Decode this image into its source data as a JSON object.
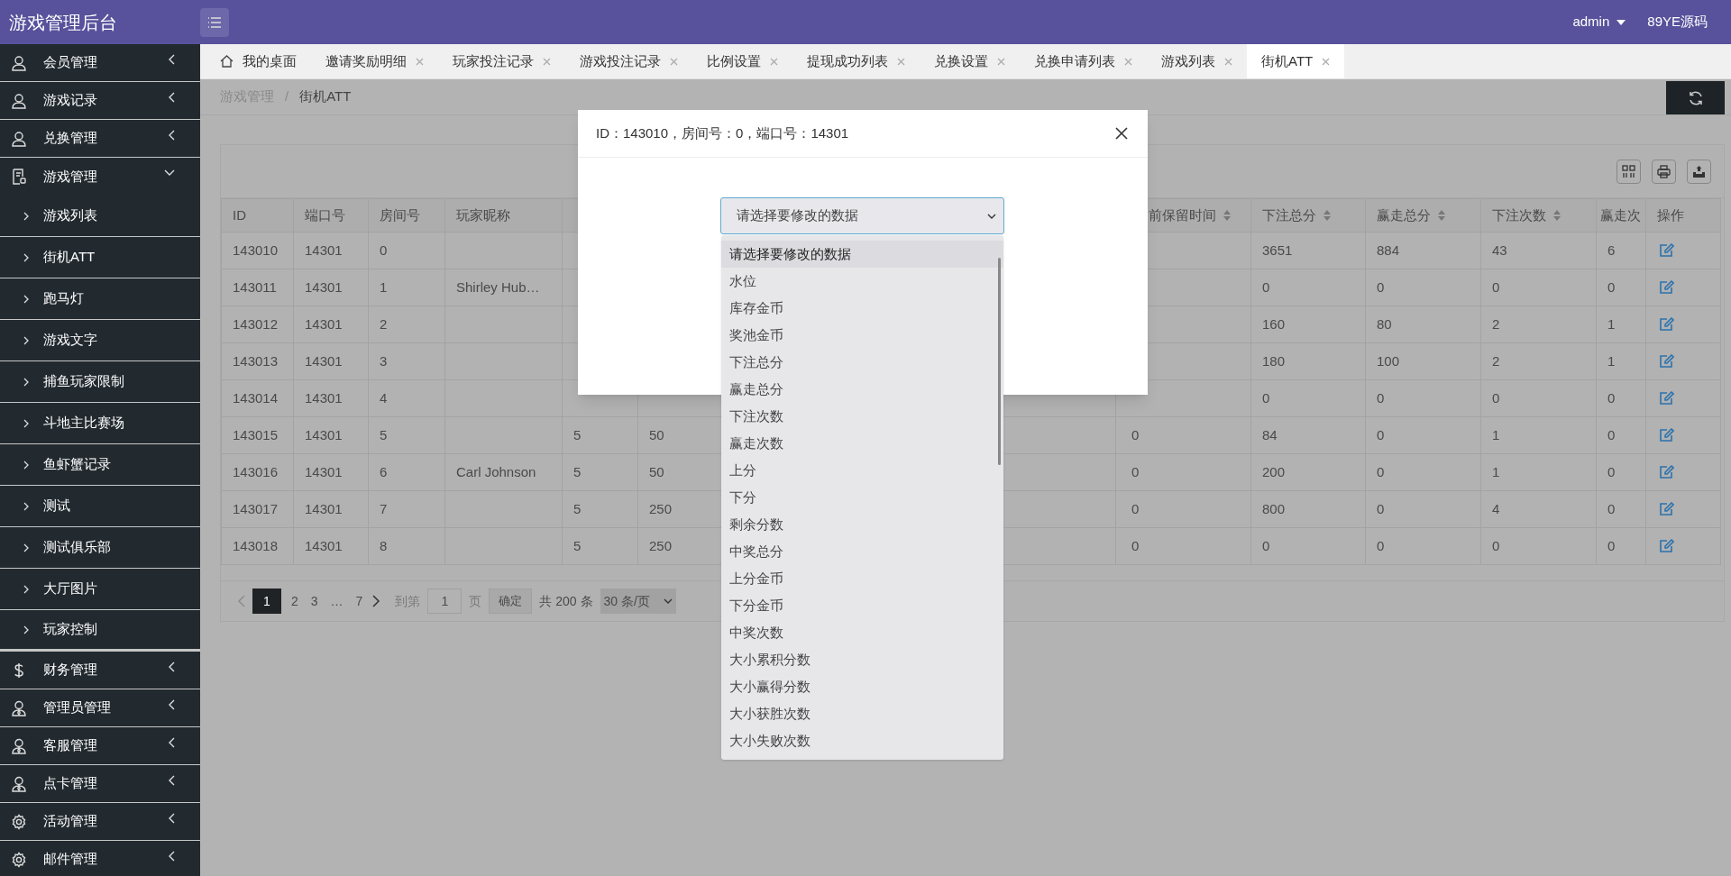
{
  "header": {
    "title": "游戏管理后台",
    "user": "admin",
    "link": "89YE源码"
  },
  "sidebar": {
    "items": [
      {
        "label": "会员管理",
        "kind": "user",
        "expanded": false
      },
      {
        "label": "游戏记录",
        "kind": "user",
        "expanded": false
      },
      {
        "label": "兑换管理",
        "kind": "user",
        "expanded": false
      },
      {
        "label": "游戏管理",
        "kind": "doc",
        "expanded": true,
        "children": [
          {
            "label": "游戏列表"
          },
          {
            "label": "街机ATT"
          },
          {
            "label": "跑马灯"
          },
          {
            "label": "游戏文字"
          },
          {
            "label": "捕鱼玩家限制"
          },
          {
            "label": "斗地主比赛场"
          },
          {
            "label": "鱼虾蟹记录"
          },
          {
            "label": "测试"
          },
          {
            "label": "测试俱乐部"
          },
          {
            "label": "大厅图片"
          },
          {
            "label": "玩家控制"
          }
        ]
      },
      {
        "label": "财务管理",
        "kind": "money",
        "expanded": false
      },
      {
        "label": "管理员管理",
        "kind": "staff",
        "expanded": false
      },
      {
        "label": "客服管理",
        "kind": "staff",
        "expanded": false
      },
      {
        "label": "点卡管理",
        "kind": "staff",
        "expanded": false
      },
      {
        "label": "活动管理",
        "kind": "gear",
        "expanded": false
      },
      {
        "label": "邮件管理",
        "kind": "gear",
        "expanded": false
      }
    ]
  },
  "tabs": [
    {
      "label": "我的桌面",
      "kind": "home",
      "selected": false
    },
    {
      "label": "邀请奖励明细",
      "kind": "page",
      "selected": false
    },
    {
      "label": "玩家投注记录",
      "kind": "page",
      "selected": false
    },
    {
      "label": "游戏投注记录",
      "kind": "page",
      "selected": false
    },
    {
      "label": "比例设置",
      "kind": "page",
      "selected": false
    },
    {
      "label": "提现成功列表",
      "kind": "page",
      "selected": false
    },
    {
      "label": "兑换设置",
      "kind": "page",
      "selected": false
    },
    {
      "label": "兑换申请列表",
      "kind": "page",
      "selected": false
    },
    {
      "label": "游戏列表",
      "kind": "page",
      "selected": false
    },
    {
      "label": "街机ATT",
      "kind": "page",
      "selected": true
    }
  ],
  "breadcrumb": {
    "items": [
      "游戏管理",
      "街机ATT"
    ],
    "separator": "/"
  },
  "table": {
    "columns": [
      {
        "label": "ID",
        "sortable": false
      },
      {
        "label": "端口号",
        "sortable": false
      },
      {
        "label": "房间号",
        "sortable": false
      },
      {
        "label": "玩家昵称",
        "sortable": false
      },
      null,
      null,
      null,
      null,
      {
        "label": "前保留时间",
        "sortable": true
      },
      {
        "label": "下注总分",
        "sortable": true
      },
      {
        "label": "赢走总分",
        "sortable": true
      },
      {
        "label": "下注次数",
        "sortable": true
      },
      {
        "label": "赢走次",
        "sortable": false
      },
      {
        "label": "操作",
        "sortable": false
      }
    ],
    "rows": [
      [
        "143010",
        "14301",
        "0",
        null,
        null,
        null,
        null,
        null,
        null,
        "3651",
        "884",
        "43",
        "6"
      ],
      [
        "143011",
        "14301",
        "1",
        "Shirley Hub…",
        null,
        null,
        null,
        null,
        null,
        "0",
        "0",
        "0",
        "0"
      ],
      [
        "143012",
        "14301",
        "2",
        null,
        null,
        null,
        null,
        null,
        null,
        "160",
        "80",
        "2",
        "1"
      ],
      [
        "143013",
        "14301",
        "3",
        null,
        null,
        null,
        null,
        null,
        null,
        "180",
        "100",
        "2",
        "1"
      ],
      [
        "143014",
        "14301",
        "4",
        null,
        null,
        null,
        null,
        null,
        null,
        "0",
        "0",
        "0",
        "0"
      ],
      [
        "143015",
        "14301",
        "5",
        null,
        "5",
        "50",
        null,
        null,
        "0",
        "84",
        "0",
        "1",
        "0"
      ],
      [
        "143016",
        "14301",
        "6",
        "Carl Johnson",
        "5",
        "50",
        null,
        null,
        "0",
        "200",
        "0",
        "1",
        "0"
      ],
      [
        "143017",
        "14301",
        "7",
        null,
        "5",
        "250",
        null,
        null,
        "0",
        "800",
        "0",
        "4",
        "0"
      ],
      [
        "143018",
        "14301",
        "8",
        null,
        "5",
        "250",
        null,
        null,
        "0",
        "0",
        "0",
        "0",
        "0"
      ]
    ]
  },
  "pagination": {
    "pages": [
      {
        "label": "1",
        "selected": true
      },
      {
        "label": "2",
        "selected": false
      },
      {
        "label": "3",
        "selected": false
      },
      {
        "label": "…",
        "selected": false
      },
      {
        "label": "7",
        "selected": false
      }
    ],
    "goto_label": "到第",
    "goto_value": "1",
    "page_unit": "页",
    "confirm": "确定",
    "total": "共 200 条",
    "page_size": "30 条/页"
  },
  "modal": {
    "title": "ID：143010，房间号：0，端口号：14301",
    "select_value": "请选择要修改的数据",
    "options": [
      {
        "label": "请选择要修改的数据",
        "selected": true
      },
      {
        "label": "水位",
        "selected": false
      },
      {
        "label": "库存金币",
        "selected": false
      },
      {
        "label": "奖池金币",
        "selected": false
      },
      {
        "label": "下注总分",
        "selected": false
      },
      {
        "label": "赢走总分",
        "selected": false
      },
      {
        "label": "下注次数",
        "selected": false
      },
      {
        "label": "赢走次数",
        "selected": false
      },
      {
        "label": "上分",
        "selected": false
      },
      {
        "label": "下分",
        "selected": false
      },
      {
        "label": "剩余分数",
        "selected": false
      },
      {
        "label": "中奖总分",
        "selected": false
      },
      {
        "label": "上分金币",
        "selected": false
      },
      {
        "label": "下分金币",
        "selected": false
      },
      {
        "label": "中奖次数",
        "selected": false
      },
      {
        "label": "大小累积分数",
        "selected": false
      },
      {
        "label": "大小赢得分数",
        "selected": false
      },
      {
        "label": "大小获胜次数",
        "selected": false
      },
      {
        "label": "大小失败次数",
        "selected": false
      }
    ]
  }
}
